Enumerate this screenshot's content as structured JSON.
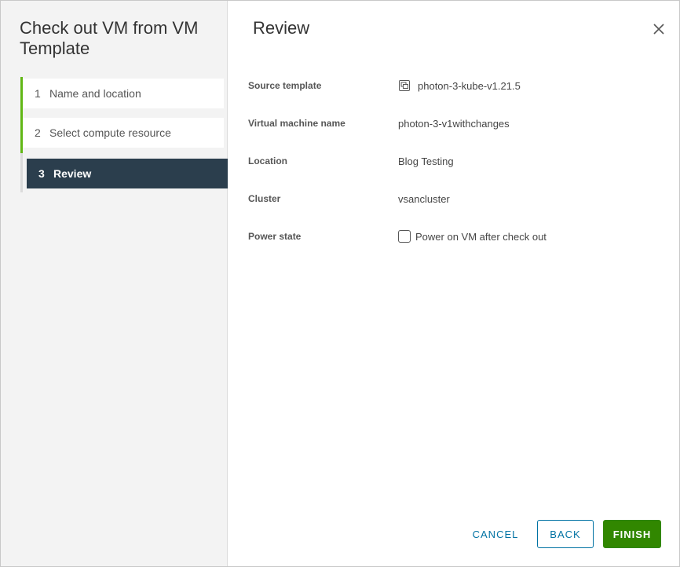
{
  "wizard": {
    "title": "Check out VM from VM Template",
    "steps": [
      {
        "num": "1",
        "label": "Name and location"
      },
      {
        "num": "2",
        "label": "Select compute resource"
      },
      {
        "num": "3",
        "label": "Review"
      }
    ]
  },
  "review": {
    "title": "Review",
    "rows": [
      {
        "label": "Source template",
        "value": "photon-3-kube-v1.21.5",
        "icon": "vm-template-icon"
      },
      {
        "label": "Virtual machine name",
        "value": "photon-3-v1withchanges"
      },
      {
        "label": "Location",
        "value": "Blog Testing"
      },
      {
        "label": "Cluster",
        "value": "vsancluster"
      },
      {
        "label": "Power state",
        "value": "Power on VM after check out",
        "checked": false
      }
    ]
  },
  "footer": {
    "cancel": "CANCEL",
    "back": "BACK",
    "finish": "FINISH"
  },
  "colors": {
    "accent_green": "#61b715",
    "active_step_bg": "#2b3e4d",
    "link_blue": "#0072a3",
    "finish_green": "#318700"
  }
}
